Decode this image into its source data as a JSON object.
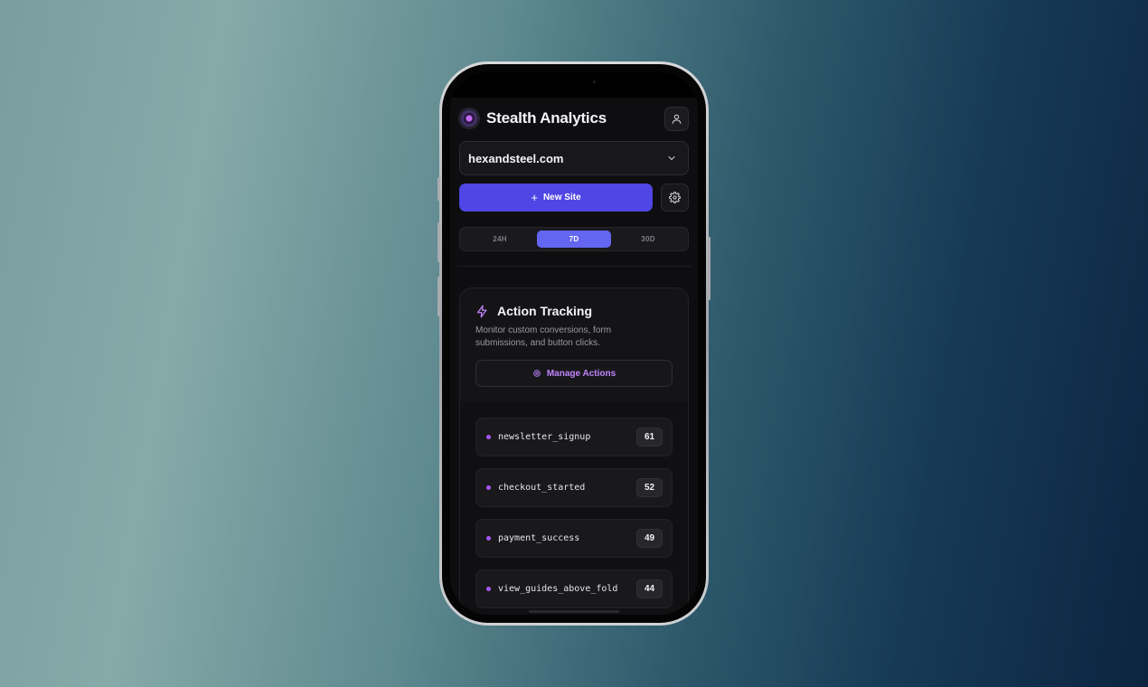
{
  "app": {
    "title": "Stealth Analytics"
  },
  "site_selector": {
    "value": "hexandsteel.com"
  },
  "actions": {
    "new_site_label": "New Site"
  },
  "time_ranges": [
    {
      "label": "24H",
      "active": false
    },
    {
      "label": "7D",
      "active": true
    },
    {
      "label": "30D",
      "active": false
    }
  ],
  "action_tracking": {
    "title": "Action Tracking",
    "description": "Monitor custom conversions, form submissions, and button clicks.",
    "manage_label": "Manage Actions",
    "items": [
      {
        "name": "newsletter_signup",
        "count": "61"
      },
      {
        "name": "checkout_started",
        "count": "52"
      },
      {
        "name": "payment_success",
        "count": "49"
      },
      {
        "name": "view_guides_above_fold",
        "count": "44"
      }
    ]
  },
  "colors": {
    "accent": "#4f46e5",
    "tab_active": "#6366f1",
    "purple": "#a855f7",
    "manage_text": "#c084fc"
  },
  "icons": {
    "user": "user-icon",
    "chevron": "chevron-down-icon",
    "plus": "plus-icon",
    "settings": "gear-icon",
    "bolt": "bolt-icon"
  }
}
